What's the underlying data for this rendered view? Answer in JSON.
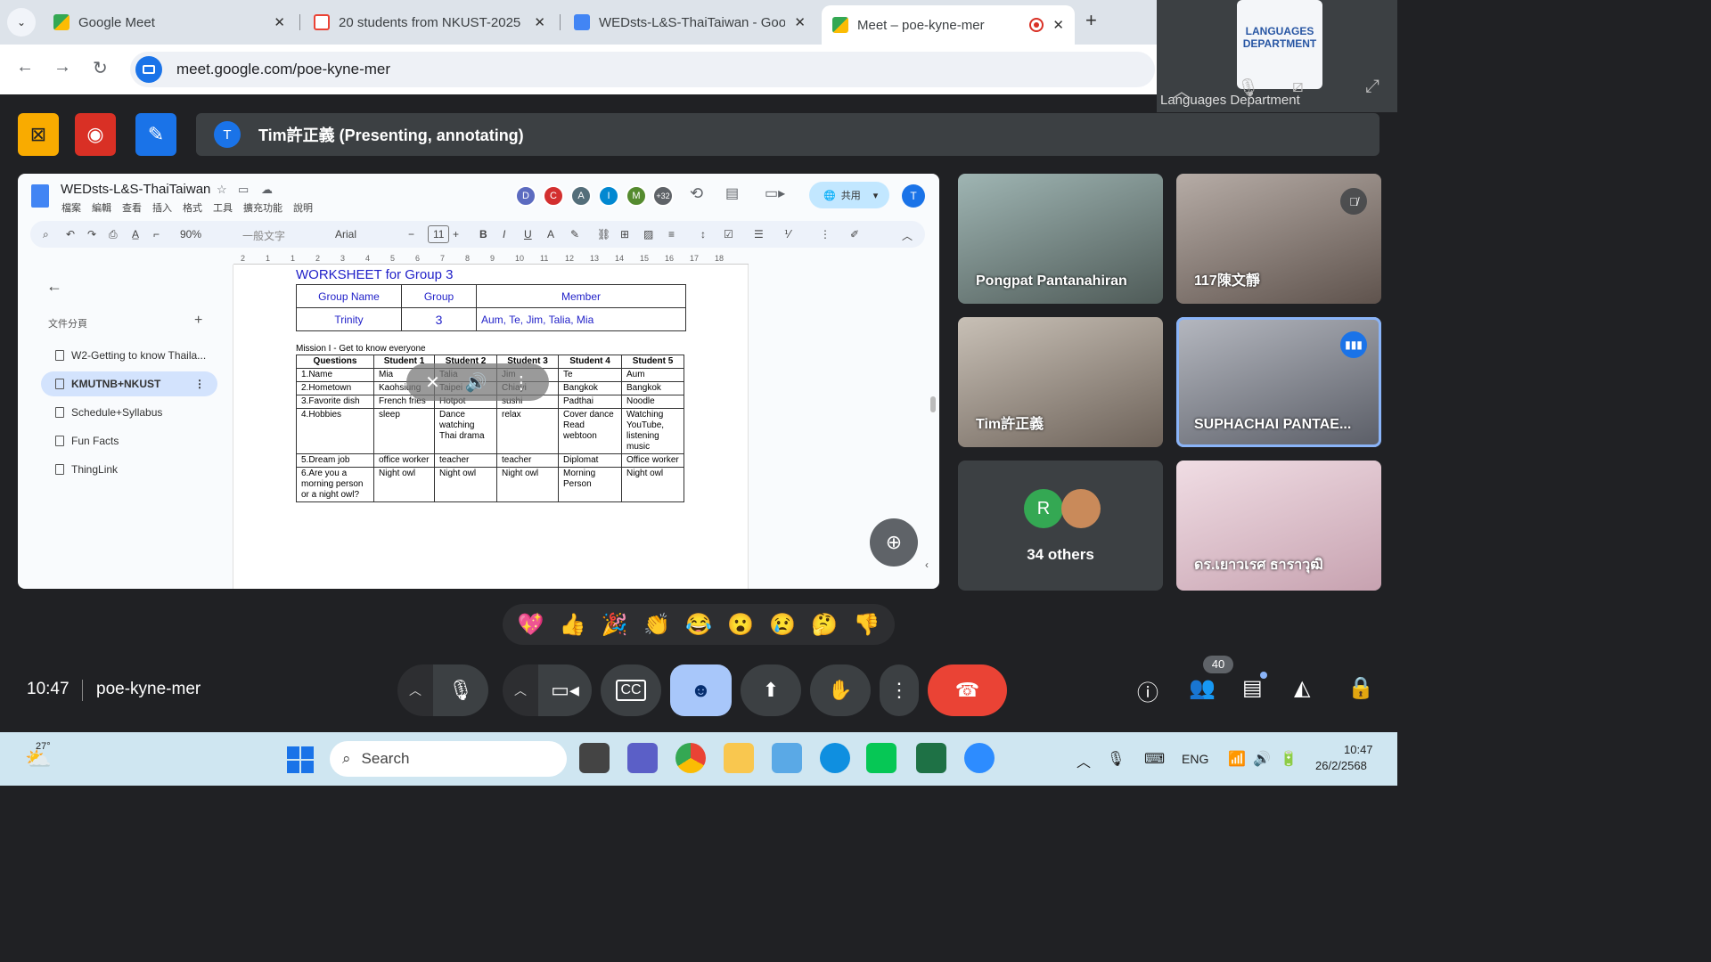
{
  "browser": {
    "tabs": [
      {
        "title": "Google Meet",
        "close": "✕"
      },
      {
        "title": "20 students from NKUST-2025",
        "close": "✕"
      },
      {
        "title": "WEDsts-L&S-ThaiTaiwan - Goog",
        "close": "✕"
      },
      {
        "title": "Meet – poe-kyne-mer",
        "close": "✕"
      }
    ],
    "new_tab": "+",
    "url": "meet.google.com/poe-kyne-mer"
  },
  "self_view": {
    "logo_line1": "LANGUAGES",
    "logo_line2": "DEPARTMENT",
    "name": "Languages Department"
  },
  "presenting": {
    "avatar_letter": "T",
    "text": "Tim許正義 (Presenting, annotating)"
  },
  "doc": {
    "title": "WEDsts-L&S-ThaiTaiwan",
    "menu": [
      "檔案",
      "編輯",
      "查看",
      "插入",
      "格式",
      "工具",
      "擴充功能",
      "說明"
    ],
    "collaborators": [
      {
        "letter": "D",
        "color": "#5c6bc0"
      },
      {
        "letter": "C",
        "color": "#d32f2f"
      },
      {
        "letter": "A",
        "color": "#546e7a"
      },
      {
        "letter": "I",
        "color": "#0288d1"
      },
      {
        "letter": "M",
        "color": "#558b2f"
      },
      {
        "letter": "+32",
        "color": "#5f6368"
      }
    ],
    "share_label": "共用",
    "me_letter": "T",
    "toolbar": {
      "zoom": "90%",
      "style": "一般文字",
      "font": "Arial",
      "size": "11"
    },
    "ruler": [
      "2",
      "1",
      "1",
      "2",
      "3",
      "4",
      "5",
      "6",
      "7",
      "8",
      "9",
      "10",
      "11",
      "12",
      "13",
      "14",
      "15",
      "16",
      "17",
      "18"
    ],
    "outline": {
      "heading": "文件分頁",
      "items": [
        {
          "label": "W2-Getting to know Thaila..."
        },
        {
          "label": "KMUTNB+NKUST"
        },
        {
          "label": "Schedule+Syllabus"
        },
        {
          "label": "Fun Facts"
        },
        {
          "label": "ThingLink"
        }
      ]
    },
    "worksheet_title": "WORKSHEET for Group 3",
    "group_table": {
      "headers": [
        "Group Name",
        "Group",
        "Member"
      ],
      "row": [
        "Trinity",
        "3",
        "Aum, Te, Jim, Talia, Mia"
      ]
    },
    "mission_title": "Mission I - Get to know everyone",
    "student_table": {
      "headers": [
        "Questions",
        "Student 1",
        "Student 2",
        "Student 3",
        "Student 4",
        "Student 5"
      ],
      "rows": [
        [
          "1.Name",
          "Mia",
          "Talia",
          "Jim",
          "Te",
          "Aum"
        ],
        [
          "2.Hometown",
          "Kaohsiung",
          "Taipei",
          "Chiayi",
          "Bangkok",
          "Bangkok"
        ],
        [
          "3.Favorite dish",
          "French fries",
          "Hotpot",
          "sushi",
          "Padthai",
          "Noodle"
        ],
        [
          "4.Hobbies",
          "sleep",
          "Dance watching Thai drama",
          "relax",
          "Cover dance Read webtoon",
          "Watching YouTube, listening music"
        ],
        [
          "5.Dream job",
          "office worker",
          "teacher",
          "teacher",
          "Diplomat",
          "Office worker"
        ],
        [
          "6.Are you a morning person or a night owl?",
          "Night owl",
          "Night owl",
          "Night owl",
          "Morning Person",
          "Night owl"
        ]
      ]
    }
  },
  "participants": [
    {
      "name": "Pongpat Pantanahiran",
      "bg": "#6d7a7a"
    },
    {
      "name": "117陳文靜",
      "bg": "#7a6f68"
    },
    {
      "name": "Tim許正義",
      "bg": "#8a8076"
    },
    {
      "name": "SUPHACHAI PANTAE...",
      "bg": "#8c8e96"
    },
    {
      "name": "ดร.เยาวเรศ ธาราวุฒิ",
      "bg": "#d9b8c4"
    }
  ],
  "others": {
    "avatar_letter": "R",
    "label": "34 others"
  },
  "reactions": [
    "💖",
    "👍",
    "🎉",
    "👏",
    "😂",
    "😮",
    "😢",
    "🤔",
    "👎"
  ],
  "meeting": {
    "time": "10:47",
    "code": "poe-kyne-mer",
    "people_count": "40"
  },
  "taskbar": {
    "weather": "27°",
    "search_placeholder": "Search",
    "language": "ENG",
    "time": "10:47",
    "date": "26/2/2568"
  },
  "colors": {
    "end_call": "#ea4335",
    "reaction_active": "#a8c7fa",
    "accent": "#1a73e8"
  }
}
